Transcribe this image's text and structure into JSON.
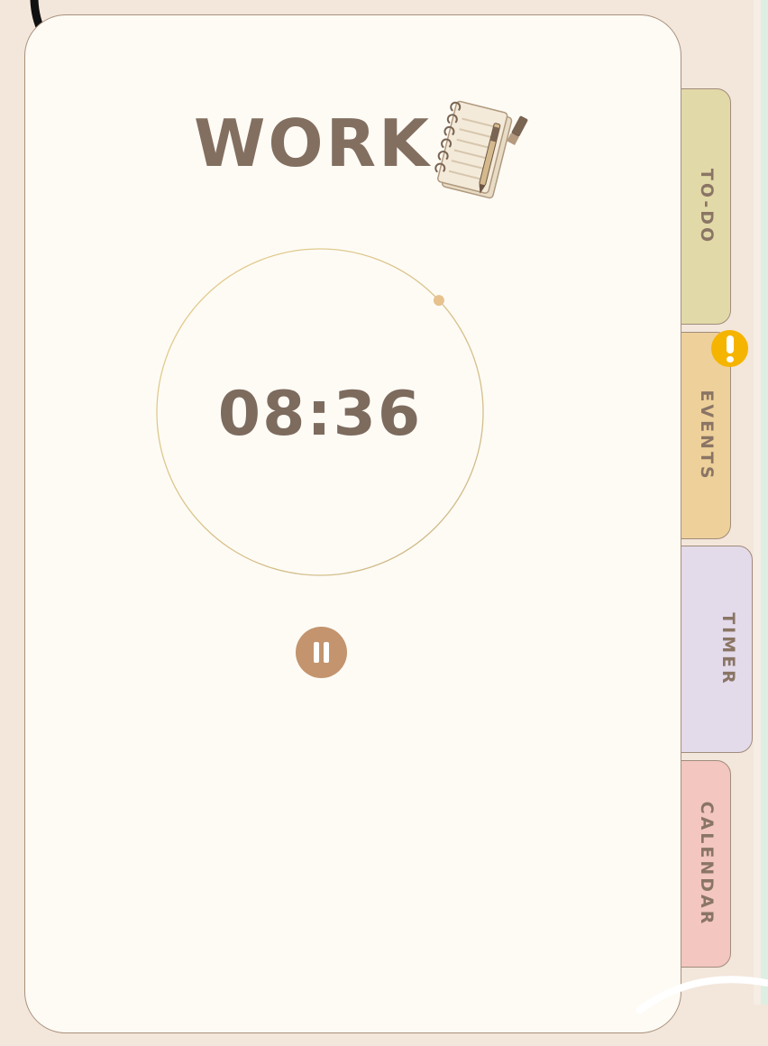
{
  "header": {
    "title": "WORK",
    "icon": "notebook-with-pen-icon"
  },
  "timer": {
    "time_display": "08:36",
    "progress": 0.13,
    "pause_icon": "pause-icon"
  },
  "tabs": [
    {
      "label": "TO-DO",
      "color": "#e2d9a8"
    },
    {
      "label": "EVENTS",
      "color": "#eed09a",
      "badge_icon": "exclamation-icon"
    },
    {
      "label": "TIMER",
      "color": "#e3daea"
    },
    {
      "label": "CALENDAR",
      "color": "#f3c6c0"
    }
  ],
  "colors": {
    "background": "#f3e6db",
    "card": "#fefbf5",
    "text": "#836f60",
    "accent": "#c3946e",
    "alert": "#f5b400"
  }
}
